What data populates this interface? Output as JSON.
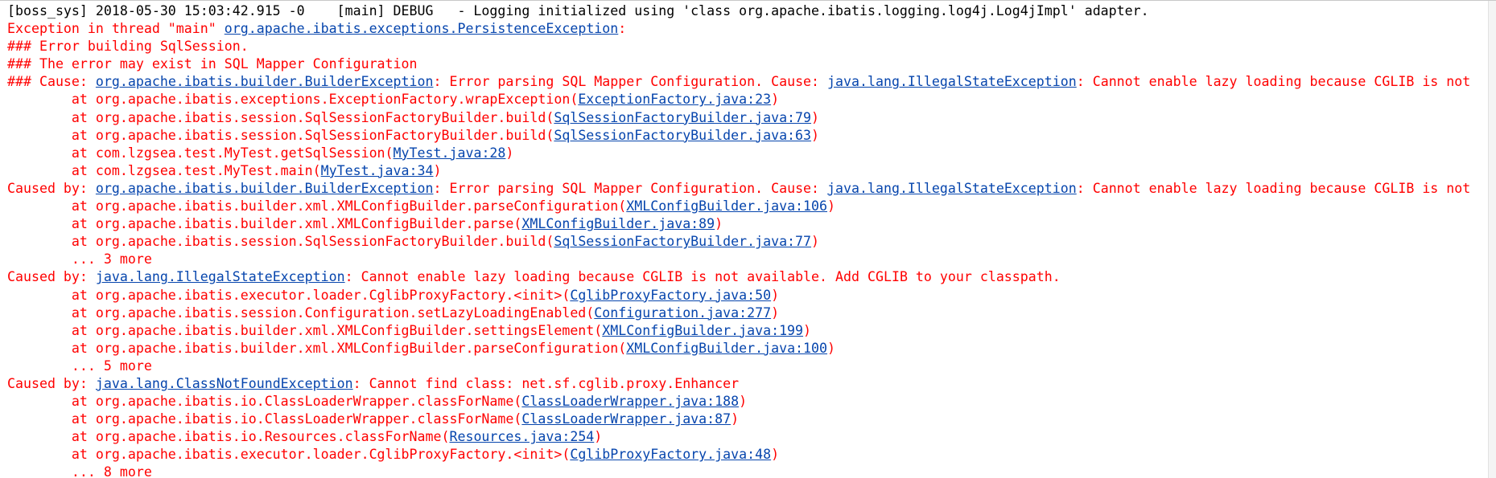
{
  "colors": {
    "background": "#ffffff",
    "info_text": "#000000",
    "error_text": "#ff0000",
    "link": "#0645ad"
  },
  "lines": [
    {
      "type": "info",
      "segments": [
        {
          "t": "[boss_sys] 2018-05-30 15:03:42.915 -0    [main] DEBUG   - Logging initialized using 'class org.apache.ibatis.logging.log4j.Log4jImpl' adapter."
        }
      ]
    },
    {
      "type": "error",
      "segments": [
        {
          "t": "Exception in thread \"main\" "
        },
        {
          "t": "org.apache.ibatis.exceptions.PersistenceException",
          "link": true
        },
        {
          "t": ":"
        }
      ]
    },
    {
      "type": "error",
      "segments": [
        {
          "t": "### Error building SqlSession."
        }
      ]
    },
    {
      "type": "error",
      "segments": [
        {
          "t": "### The error may exist in SQL Mapper Configuration"
        }
      ]
    },
    {
      "type": "error",
      "segments": [
        {
          "t": "### Cause: "
        },
        {
          "t": "org.apache.ibatis.builder.BuilderException",
          "link": true
        },
        {
          "t": ": Error parsing SQL Mapper Configuration. Cause: "
        },
        {
          "t": "java.lang.IllegalStateException",
          "link": true
        },
        {
          "t": ": Cannot enable lazy loading because CGLIB is not"
        }
      ]
    },
    {
      "type": "error",
      "segments": [
        {
          "t": "\tat org.apache.ibatis.exceptions.ExceptionFactory.wrapException("
        },
        {
          "t": "ExceptionFactory.java:23",
          "link": true
        },
        {
          "t": ")"
        }
      ]
    },
    {
      "type": "error",
      "segments": [
        {
          "t": "\tat org.apache.ibatis.session.SqlSessionFactoryBuilder.build("
        },
        {
          "t": "SqlSessionFactoryBuilder.java:79",
          "link": true
        },
        {
          "t": ")"
        }
      ]
    },
    {
      "type": "error",
      "segments": [
        {
          "t": "\tat org.apache.ibatis.session.SqlSessionFactoryBuilder.build("
        },
        {
          "t": "SqlSessionFactoryBuilder.java:63",
          "link": true
        },
        {
          "t": ")"
        }
      ]
    },
    {
      "type": "error",
      "segments": [
        {
          "t": "\tat com.lzgsea.test.MyTest.getSqlSession("
        },
        {
          "t": "MyTest.java:28",
          "link": true
        },
        {
          "t": ")"
        }
      ]
    },
    {
      "type": "error",
      "segments": [
        {
          "t": "\tat com.lzgsea.test.MyTest.main("
        },
        {
          "t": "MyTest.java:34",
          "link": true
        },
        {
          "t": ")"
        }
      ]
    },
    {
      "type": "error",
      "segments": [
        {
          "t": "Caused by: "
        },
        {
          "t": "org.apache.ibatis.builder.BuilderException",
          "link": true
        },
        {
          "t": ": Error parsing SQL Mapper Configuration. Cause: "
        },
        {
          "t": "java.lang.IllegalStateException",
          "link": true
        },
        {
          "t": ": Cannot enable lazy loading because CGLIB is not"
        }
      ]
    },
    {
      "type": "error",
      "segments": [
        {
          "t": "\tat org.apache.ibatis.builder.xml.XMLConfigBuilder.parseConfiguration("
        },
        {
          "t": "XMLConfigBuilder.java:106",
          "link": true
        },
        {
          "t": ")"
        }
      ]
    },
    {
      "type": "error",
      "segments": [
        {
          "t": "\tat org.apache.ibatis.builder.xml.XMLConfigBuilder.parse("
        },
        {
          "t": "XMLConfigBuilder.java:89",
          "link": true
        },
        {
          "t": ")"
        }
      ]
    },
    {
      "type": "error",
      "segments": [
        {
          "t": "\tat org.apache.ibatis.session.SqlSessionFactoryBuilder.build("
        },
        {
          "t": "SqlSessionFactoryBuilder.java:77",
          "link": true
        },
        {
          "t": ")"
        }
      ]
    },
    {
      "type": "error",
      "segments": [
        {
          "t": "\t... 3 more"
        }
      ]
    },
    {
      "type": "error",
      "segments": [
        {
          "t": "Caused by: "
        },
        {
          "t": "java.lang.IllegalStateException",
          "link": true
        },
        {
          "t": ": Cannot enable lazy loading because CGLIB is not available. Add CGLIB to your classpath."
        }
      ]
    },
    {
      "type": "error",
      "segments": [
        {
          "t": "\tat org.apache.ibatis.executor.loader.CglibProxyFactory.<init>("
        },
        {
          "t": "CglibProxyFactory.java:50",
          "link": true
        },
        {
          "t": ")"
        }
      ]
    },
    {
      "type": "error",
      "segments": [
        {
          "t": "\tat org.apache.ibatis.session.Configuration.setLazyLoadingEnabled("
        },
        {
          "t": "Configuration.java:277",
          "link": true
        },
        {
          "t": ")"
        }
      ]
    },
    {
      "type": "error",
      "segments": [
        {
          "t": "\tat org.apache.ibatis.builder.xml.XMLConfigBuilder.settingsElement("
        },
        {
          "t": "XMLConfigBuilder.java:199",
          "link": true
        },
        {
          "t": ")"
        }
      ]
    },
    {
      "type": "error",
      "segments": [
        {
          "t": "\tat org.apache.ibatis.builder.xml.XMLConfigBuilder.parseConfiguration("
        },
        {
          "t": "XMLConfigBuilder.java:100",
          "link": true
        },
        {
          "t": ")"
        }
      ]
    },
    {
      "type": "error",
      "segments": [
        {
          "t": "\t... 5 more"
        }
      ]
    },
    {
      "type": "error",
      "segments": [
        {
          "t": "Caused by: "
        },
        {
          "t": "java.lang.ClassNotFoundException",
          "link": true
        },
        {
          "t": ": Cannot find class: net.sf.cglib.proxy.Enhancer"
        }
      ]
    },
    {
      "type": "error",
      "segments": [
        {
          "t": "\tat org.apache.ibatis.io.ClassLoaderWrapper.classForName("
        },
        {
          "t": "ClassLoaderWrapper.java:188",
          "link": true
        },
        {
          "t": ")"
        }
      ]
    },
    {
      "type": "error",
      "segments": [
        {
          "t": "\tat org.apache.ibatis.io.ClassLoaderWrapper.classForName("
        },
        {
          "t": "ClassLoaderWrapper.java:87",
          "link": true
        },
        {
          "t": ")"
        }
      ]
    },
    {
      "type": "error",
      "segments": [
        {
          "t": "\tat org.apache.ibatis.io.Resources.classForName("
        },
        {
          "t": "Resources.java:254",
          "link": true
        },
        {
          "t": ")"
        }
      ]
    },
    {
      "type": "error",
      "segments": [
        {
          "t": "\tat org.apache.ibatis.executor.loader.CglibProxyFactory.<init>("
        },
        {
          "t": "CglibProxyFactory.java:48",
          "link": true
        },
        {
          "t": ")"
        }
      ]
    },
    {
      "type": "error",
      "segments": [
        {
          "t": "\t... 8 more"
        }
      ]
    }
  ]
}
